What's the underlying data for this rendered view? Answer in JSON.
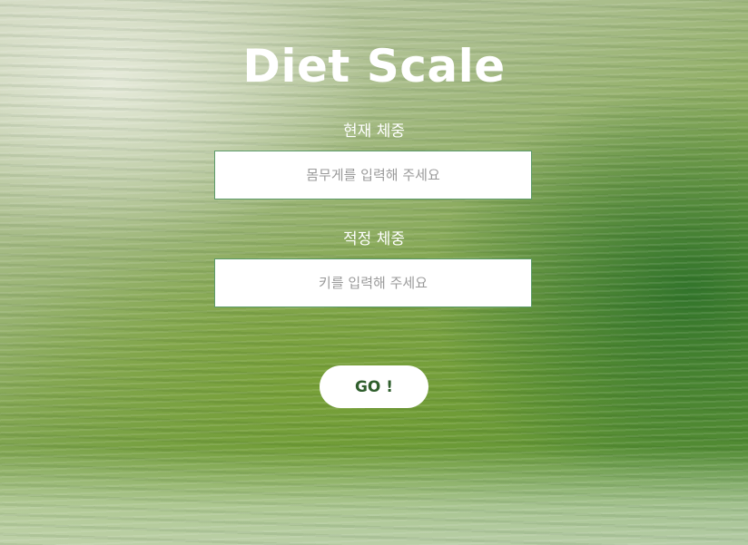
{
  "app": {
    "title": "Diet Scale"
  },
  "form": {
    "current_weight": {
      "label": "현재 체중",
      "value": "",
      "placeholder": "몸무게를 입력해 주세요"
    },
    "ideal_weight": {
      "label": "적정 체중",
      "value": "",
      "placeholder": "키를 입력해 주세요"
    },
    "submit_label": "GO !"
  },
  "theme": {
    "text_color": "#ffffff",
    "button_text_color": "#2f5e2c",
    "input_border_color": "#5c9a6a",
    "placeholder_color": "#9a9a9a"
  }
}
